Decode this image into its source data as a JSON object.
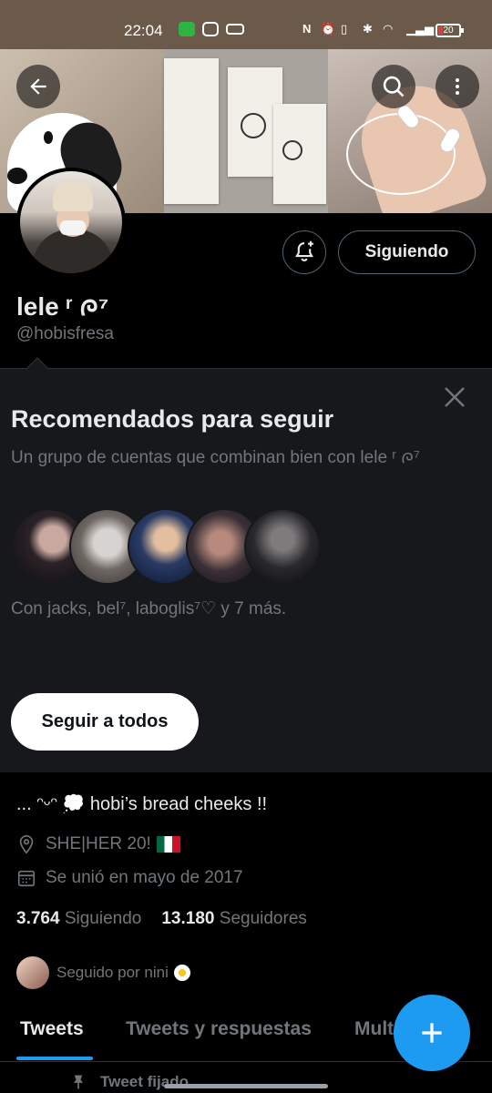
{
  "status_bar": {
    "time": "22:04",
    "battery": "20"
  },
  "profile": {
    "name": "lele ʳ ᰍ⁷",
    "handle": "@hobisfresa",
    "follow_button": "Siguiendo",
    "bio": "... ᵔᵕᵔ 💭 hobi’s bread cheeks !!",
    "location": "SHE|HER 20!",
    "joined": "Se unió en mayo de 2017",
    "following_count": "3.764",
    "following_label": "Siguiendo",
    "followers_count": "13.180",
    "followers_label": "Seguidores",
    "followed_by": "Seguido por nini"
  },
  "recommendations": {
    "title": "Recomendados para seguir",
    "description": "Un grupo de cuentas que combinan bien con lele ʳ ᰍ⁷",
    "with_text": "Con jacks, bel⁷, laboglis⁷♡ y 7 más.",
    "follow_all_button": "Seguir a todos"
  },
  "tabs": [
    "Tweets",
    "Tweets y respuestas",
    "Multimedia"
  ],
  "pinned_label": "Tweet fijado",
  "colors": {
    "accent": "#1d9bf0",
    "background": "#000000",
    "card": "#16181c",
    "muted": "#71767b"
  }
}
